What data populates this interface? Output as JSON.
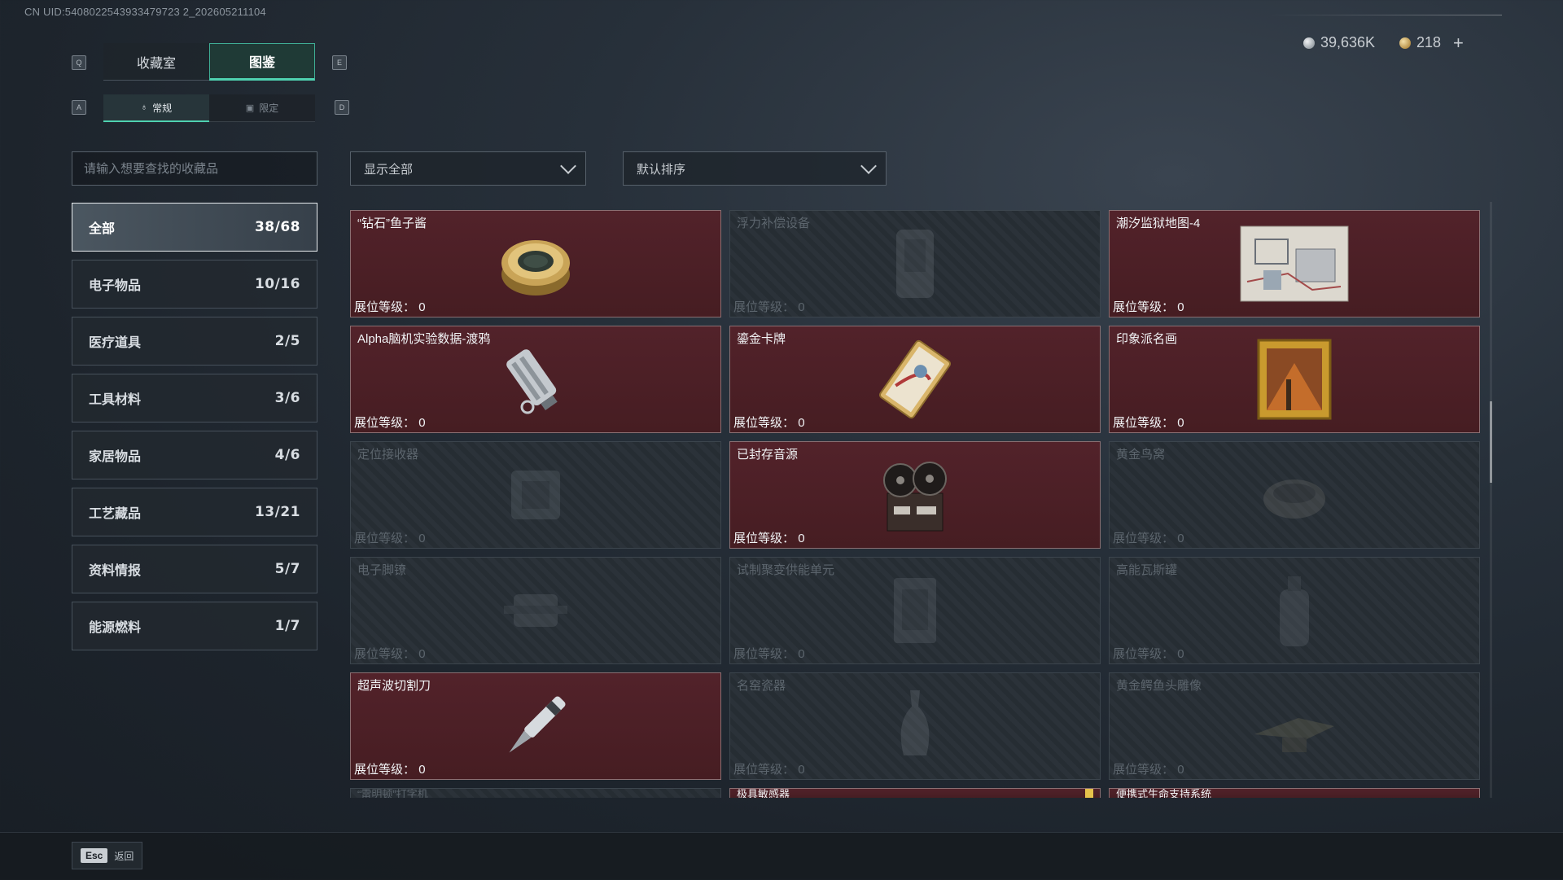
{
  "uid": "CN UID:5408022543933479723 2_202605211104",
  "currency": {
    "silver": "39,636K",
    "gold": "218",
    "plus": "+"
  },
  "keys": {
    "prev_tab": "Q",
    "next_tab": "E",
    "prev_sub": "A",
    "next_sub": "D"
  },
  "tabs": [
    {
      "label": "收藏室"
    },
    {
      "label": "图鉴"
    }
  ],
  "subtabs": [
    {
      "label": "常规"
    },
    {
      "label": "限定"
    }
  ],
  "search": {
    "placeholder": "请输入想要查找的收藏品",
    "value": ""
  },
  "filters": {
    "show": "显示全部",
    "sort": "默认排序"
  },
  "categories": [
    {
      "label": "全部",
      "count": "38/68"
    },
    {
      "label": "电子物品",
      "count": "10/16"
    },
    {
      "label": "医疗道具",
      "count": "2/5"
    },
    {
      "label": "工具材料",
      "count": "3/6"
    },
    {
      "label": "家居物品",
      "count": "4/6"
    },
    {
      "label": "工艺藏品",
      "count": "13/21"
    },
    {
      "label": "资料情报",
      "count": "5/7"
    },
    {
      "label": "能源燃料",
      "count": "1/7"
    }
  ],
  "level_label": "展位等级：",
  "items": [
    {
      "name": "“钻石”鱼子酱",
      "level": "0",
      "icon": "caviar-tin-icon"
    },
    {
      "name": "浮力补偿设备",
      "level": "0",
      "icon": "buoyancy-device-icon"
    },
    {
      "name": "潮汐监狱地图-4",
      "level": "0",
      "icon": "map-icon"
    },
    {
      "name": "Alpha脑机实验数据-渡鸦",
      "level": "0",
      "icon": "data-drive-icon"
    },
    {
      "name": "鎏金卡牌",
      "level": "0",
      "icon": "gold-card-icon"
    },
    {
      "name": "印象派名画",
      "level": "0",
      "icon": "painting-icon"
    },
    {
      "name": "定位接收器",
      "level": "0",
      "icon": "receiver-icon"
    },
    {
      "name": "已封存音源",
      "level": "0",
      "icon": "reel-recorder-icon"
    },
    {
      "name": "黄金鸟窝",
      "level": "0",
      "icon": "bird-nest-icon"
    },
    {
      "name": "电子脚镣",
      "level": "0",
      "icon": "ankle-monitor-icon"
    },
    {
      "name": "试制聚变供能单元",
      "level": "0",
      "icon": "fusion-unit-icon"
    },
    {
      "name": "高能瓦斯罐",
      "level": "0",
      "icon": "gas-canister-icon"
    },
    {
      "name": "超声波切割刀",
      "level": "0",
      "icon": "cutter-icon"
    },
    {
      "name": "名窑瓷器",
      "level": "0",
      "icon": "vase-icon"
    },
    {
      "name": "黄金鳄鱼头雕像",
      "level": "0",
      "icon": "croc-statue-icon"
    },
    {
      "name": "“雷明顿”打字机"
    },
    {
      "name": "极具敏感器"
    },
    {
      "name": "便携式生命支持系统"
    }
  ],
  "footer": {
    "esc_key": "Esc",
    "back_label": "返回"
  }
}
